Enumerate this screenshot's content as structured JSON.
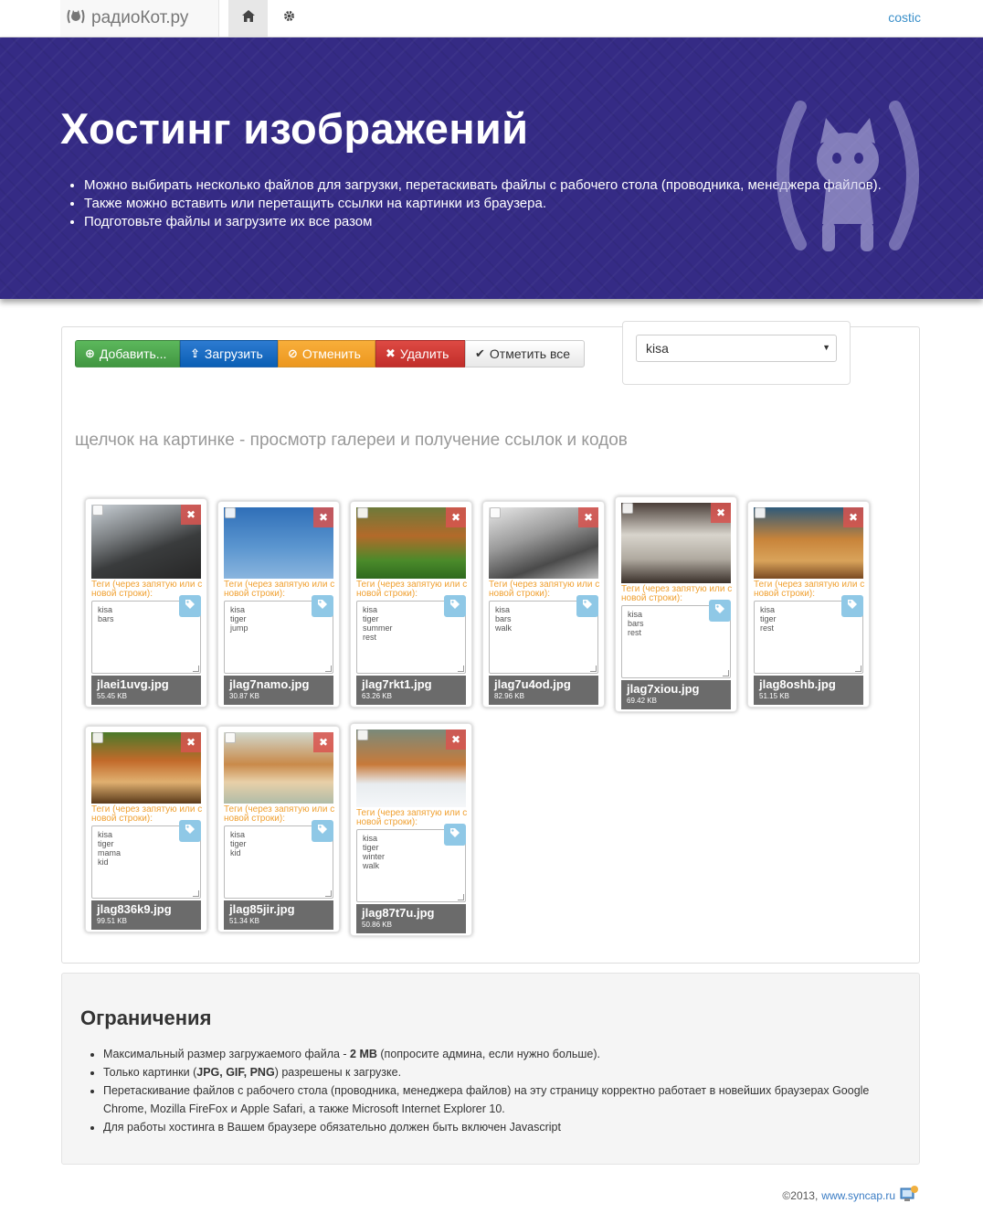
{
  "nav": {
    "brand": "радиоКот.ру",
    "user": "costic"
  },
  "hero": {
    "title": "Хостинг изображений",
    "bullets": [
      "Можно выбирать несколько файлов для загрузки, перетаскивать файлы с рабочего стола (проводника, менеджера файлов).",
      "Также можно вставить или перетащить ссылки на картинки из браузера.",
      "Подготовьте файлы и загрузите их все разом"
    ]
  },
  "toolbar": {
    "add": "Добавить...",
    "upload": "Загрузить",
    "cancel": "Отменить",
    "delete": "Удалить",
    "check_all": "Отметить все"
  },
  "album": {
    "selected": "kisa"
  },
  "hint": "щелчок на картинке - просмотр галереи и получение ссылок и кодов",
  "tags_label": "Теги (через запятую или с новой строки):",
  "images": [
    {
      "name": "jlaei1uvg.jpg",
      "size": "55.45 KB",
      "tags": "kisa\nbars",
      "theme": "snowleopard-dark"
    },
    {
      "name": "jlag7namo.jpg",
      "size": "30.87 KB",
      "tags": "kisa\ntiger\njump",
      "theme": "tiger-jump"
    },
    {
      "name": "jlag7rkt1.jpg",
      "size": "63.26 KB",
      "tags": "kisa\ntiger\nsummer\nrest",
      "theme": "tiger-grass"
    },
    {
      "name": "jlag7u4od.jpg",
      "size": "82.96 KB",
      "tags": "kisa\nbars\nwalk",
      "theme": "snowleopard-bw"
    },
    {
      "name": "jlag7xiou.jpg",
      "size": "69.42 KB",
      "tags": "kisa\nbars\nrest",
      "theme": "snowleopard-rock"
    },
    {
      "name": "jlag8oshb.jpg",
      "size": "51.15 KB",
      "tags": "kisa\ntiger\nrest",
      "theme": "tiger-lying"
    },
    {
      "name": "jlag836k9.jpg",
      "size": "99.51 KB",
      "tags": "kisa\ntiger\nmama\nkid",
      "theme": "tiger-mama"
    },
    {
      "name": "jlag85jir.jpg",
      "size": "51.34 KB",
      "tags": "kisa\ntiger\nkid",
      "theme": "tiger-cub"
    },
    {
      "name": "jlag87t7u.jpg",
      "size": "50.86 KB",
      "tags": "kisa\ntiger\nwinter\nwalk",
      "theme": "tiger-snow"
    }
  ],
  "limits": {
    "title": "Ограничения",
    "items": [
      [
        "Максимальный размер загружаемого файла - ",
        "2 MB",
        " (попросите админа, если нужно больше)."
      ],
      [
        "Только картинки (",
        "JPG, GIF, PNG",
        ") разрешены к загрузке."
      ],
      [
        "Перетаскивание файлов с рабочего стола (проводника, менеджера файлов) на эту страницу корректно работает в новейших браузерах Google Chrome, Mozilla FireFox и Apple Safari, а также Microsoft Internet Explorer 10.",
        "",
        ""
      ],
      [
        "Для работы хостинга в Вашем браузере обязательно должен быть включен Javascript",
        "",
        ""
      ]
    ]
  },
  "footer": {
    "copy": "©2013,",
    "link": "www.syncap.ru"
  }
}
